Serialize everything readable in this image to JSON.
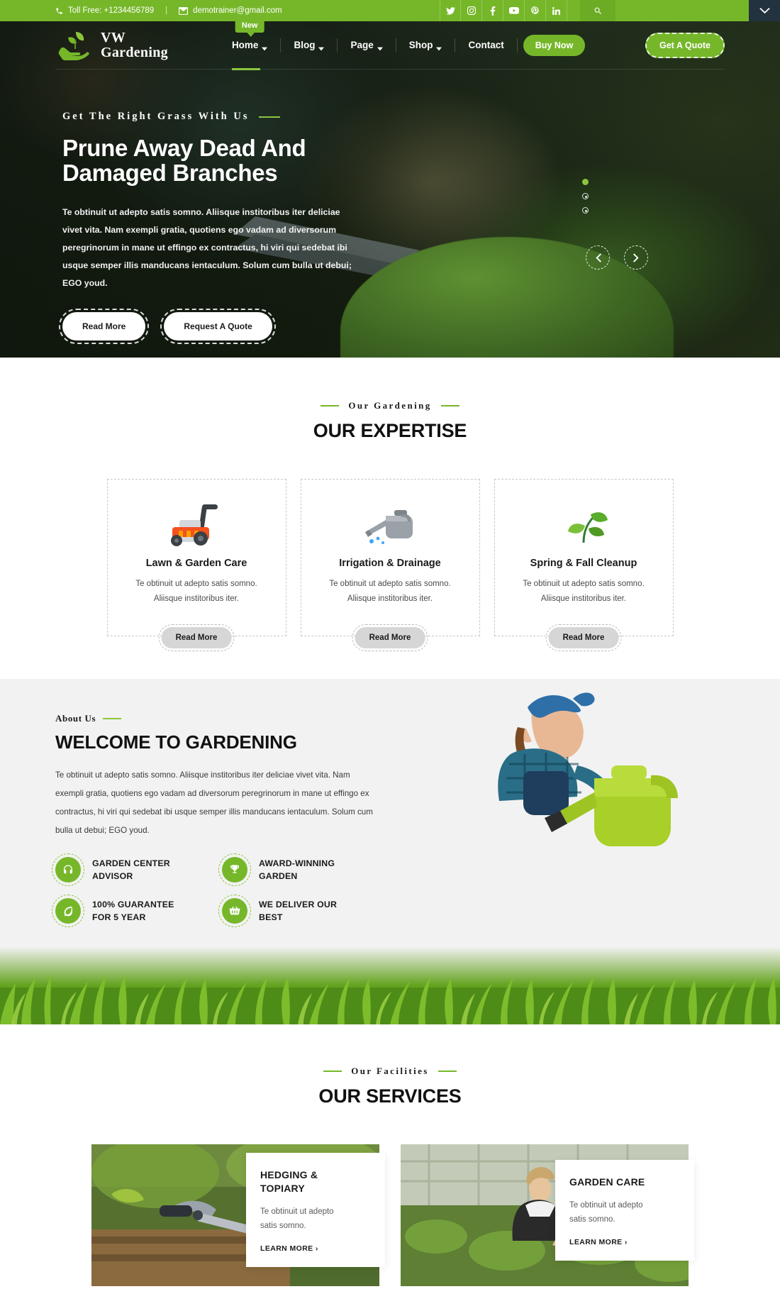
{
  "topbar": {
    "phone": "Toll Free: +1234456789",
    "separator": "|",
    "email": "demotrainer@gmail.com",
    "social": [
      {
        "name": "twitter-icon",
        "label": "Twitter"
      },
      {
        "name": "instagram-icon",
        "label": "Instagram"
      },
      {
        "name": "facebook-icon",
        "label": "Facebook"
      },
      {
        "name": "youtube-icon",
        "label": "YouTube"
      },
      {
        "name": "pinterest-icon",
        "label": "Pinterest"
      },
      {
        "name": "linkedin-icon",
        "label": "LinkedIn"
      }
    ],
    "search_icon": "search-icon",
    "toggle_icon": "chevron-down-icon",
    "bg_color": "#76b72a"
  },
  "header": {
    "logo_line1": "VW",
    "logo_line2": "Gardening",
    "logo_icon": "hand-plant-icon",
    "nav": [
      {
        "label": "Home",
        "caret": true,
        "badge": "New",
        "active": true
      },
      {
        "label": "Blog",
        "caret": true,
        "badge": null,
        "active": false
      },
      {
        "label": "Page",
        "caret": true,
        "badge": null,
        "active": false
      },
      {
        "label": "Shop",
        "caret": true,
        "badge": null,
        "active": false
      },
      {
        "label": "Contact",
        "caret": false,
        "badge": null,
        "active": false
      }
    ],
    "buy_now": "Buy Now",
    "get_quote": "Get A Quote",
    "accent_color": "#76b72a"
  },
  "hero": {
    "eyebrow": "Get The Right Grass With Us",
    "title_line1": "Prune Away Dead And",
    "title_line2": "Damaged Branches",
    "paragraph": "Te obtinuit ut adepto satis somno. Aliisque institoribus iter deliciae vivet vita. Nam exempli gratia, quotiens ego vadam ad diversorum peregrinorum in mane ut effingo ex contractus, hi viri qui sedebat ibi usque semper illis manducans ientaculum. Solum cum bulla ut debui; EGO youd.",
    "btn_primary": "Read More",
    "btn_secondary": "Request A Quote",
    "prev_icon": "chevron-left-icon",
    "next_icon": "chevron-right-icon",
    "slide_dots": 3,
    "active_dot": 1
  },
  "expertise": {
    "eyebrow": "Our Gardening",
    "title": "OUR EXPERTISE",
    "cards": [
      {
        "icon": "lawn-mower-icon",
        "title": "Lawn & Garden Care",
        "desc_line1": "Te obtinuit ut adepto satis somno.",
        "desc_line2": "Aliisque institoribus iter.",
        "button": "Read More"
      },
      {
        "icon": "watering-can-icon",
        "title": "Irrigation & Drainage",
        "desc_line1": "Te obtinuit ut adepto satis somno.",
        "desc_line2": "Aliisque institoribus iter.",
        "button": "Read More"
      },
      {
        "icon": "sprout-leaf-icon",
        "title": "Spring & Fall Cleanup",
        "desc_line1": "Te obtinuit ut adepto satis somno.",
        "desc_line2": "Aliisque institoribus iter.",
        "button": "Read More"
      }
    ]
  },
  "about": {
    "eyebrow": "About Us",
    "title": "WELCOME TO GARDENING",
    "paragraph": "Te obtinuit ut adepto satis somno. Aliisque institoribus iter deliciae vivet vita. Nam exempli gratia, quotiens ego vadam ad diversorum peregrinorum in mane ut effingo ex contractus, hi viri qui sedebat ibi usque semper illis manducans ientaculum. Solum cum bulla ut debui; EGO youd.",
    "features": [
      {
        "icon": "headset-icon",
        "line1": "GARDEN CENTER",
        "line2": "ADVISOR"
      },
      {
        "icon": "trophy-icon",
        "line1": "AWARD-WINNING",
        "line2": "GARDEN"
      },
      {
        "icon": "leaf-icon",
        "line1": "100% GUARANTEE",
        "line2": "FOR 5 YEAR"
      },
      {
        "icon": "basket-icon",
        "line1": "WE DELIVER OUR",
        "line2": "BEST"
      }
    ],
    "photo_alt": "woman-watering-can-photo",
    "bg_color": "#f2f2f2"
  },
  "services": {
    "eyebrow": "Our Facilities",
    "title": "OUR SERVICES",
    "items": [
      {
        "image": "hedging-photo",
        "title_line1": "HEDGING &",
        "title_line2": "TOPIARY",
        "desc_line1": "Te obtinuit ut adepto",
        "desc_line2": "satis somno.",
        "link": "LEARN MORE ›"
      },
      {
        "image": "garden-care-photo",
        "title_line1": "GARDEN CARE",
        "title_line2": "",
        "desc_line1": "Te obtinuit ut adepto",
        "desc_line2": "satis somno.",
        "link": "LEARN MORE ›"
      }
    ]
  }
}
